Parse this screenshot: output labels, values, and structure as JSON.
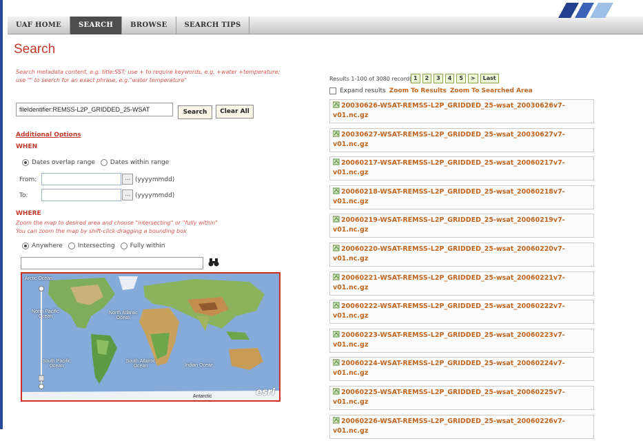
{
  "nav": {
    "items": [
      "UAF HOME",
      "SEARCH",
      "BROWSE",
      "SEARCH TIPS"
    ],
    "active": "SEARCH"
  },
  "page": {
    "title": "Search"
  },
  "search": {
    "hint": "Search metadata content, e.g. title:SST; use + to require keywords, e.g. +water +temperature;\nuse \"\" to search for an exact phrase, e.g.\"water temperature\"",
    "value": "fileIdentifier:REMSS-L2P_GRIDDED_25-WSAT",
    "search_label": "Search",
    "clear_label": "Clear All"
  },
  "options": {
    "title": "Additional Options",
    "when": {
      "heading": "WHEN",
      "radio1": "Dates overlap range",
      "radio2": "Dates within range",
      "from_label": "From:",
      "to_label": "To:",
      "date_btn": "...",
      "format": "(yyyymmdd)"
    },
    "where": {
      "heading": "WHERE",
      "hint": "Zoom the map to desired area and choose \"intersecting\" or \"fully within\"\nYou can zoom the map by shift-click-dragging a bounding box",
      "radio1": "Anywhere",
      "radio2": "Intersecting",
      "radio3": "Fully within"
    }
  },
  "map": {
    "labels": {
      "arctic": "Arctic Ocean",
      "npacific": "North Pacific Ocean",
      "natlantic": "North Atlantic Ocean",
      "spacific": "South Pacific Ocean",
      "satlantic": "South Atlantic Ocean",
      "indian": "Indian Ocean",
      "antarctic": "Antarctic"
    },
    "logo": "esri"
  },
  "results": {
    "summary": "Results 1-100 of 3080 record(s)",
    "pages": [
      "1",
      "2",
      "3",
      "4",
      "5",
      ">",
      "Last"
    ],
    "expand_label": "Expand results",
    "zoom_results": "Zoom To Results",
    "zoom_area": "Zoom To Searched Area",
    "items": [
      "20030626-WSAT-REMSS-L2P_GRIDDED_25-wsat_20030626v7-v01.nc.gz",
      "20030627-WSAT-REMSS-L2P_GRIDDED_25-wsat_20030627v7-v01.nc.gz",
      "20060217-WSAT-REMSS-L2P_GRIDDED_25-wsat_20060217v7-v01.nc.gz",
      "20060218-WSAT-REMSS-L2P_GRIDDED_25-wsat_20060218v7-v01.nc.gz",
      "20060219-WSAT-REMSS-L2P_GRIDDED_25-wsat_20060219v7-v01.nc.gz",
      "20060220-WSAT-REMSS-L2P_GRIDDED_25-wsat_20060220v7-v01.nc.gz",
      "20060221-WSAT-REMSS-L2P_GRIDDED_25-wsat_20060221v7-v01.nc.gz",
      "20060222-WSAT-REMSS-L2P_GRIDDED_25-wsat_20060222v7-v01.nc.gz",
      "20060223-WSAT-REMSS-L2P_GRIDDED_25-wsat_20060223v7-v01.nc.gz",
      "20060224-WSAT-REMSS-L2P_GRIDDED_25-wsat_20060224v7-v01.nc.gz",
      "20060225-WSAT-REMSS-L2P_GRIDDED_25-wsat_20060225v7-v01.nc.gz",
      "20060226-WSAT-REMSS-L2P_GRIDDED_25-wsat_20060226v7-v01.nc.gz"
    ]
  }
}
